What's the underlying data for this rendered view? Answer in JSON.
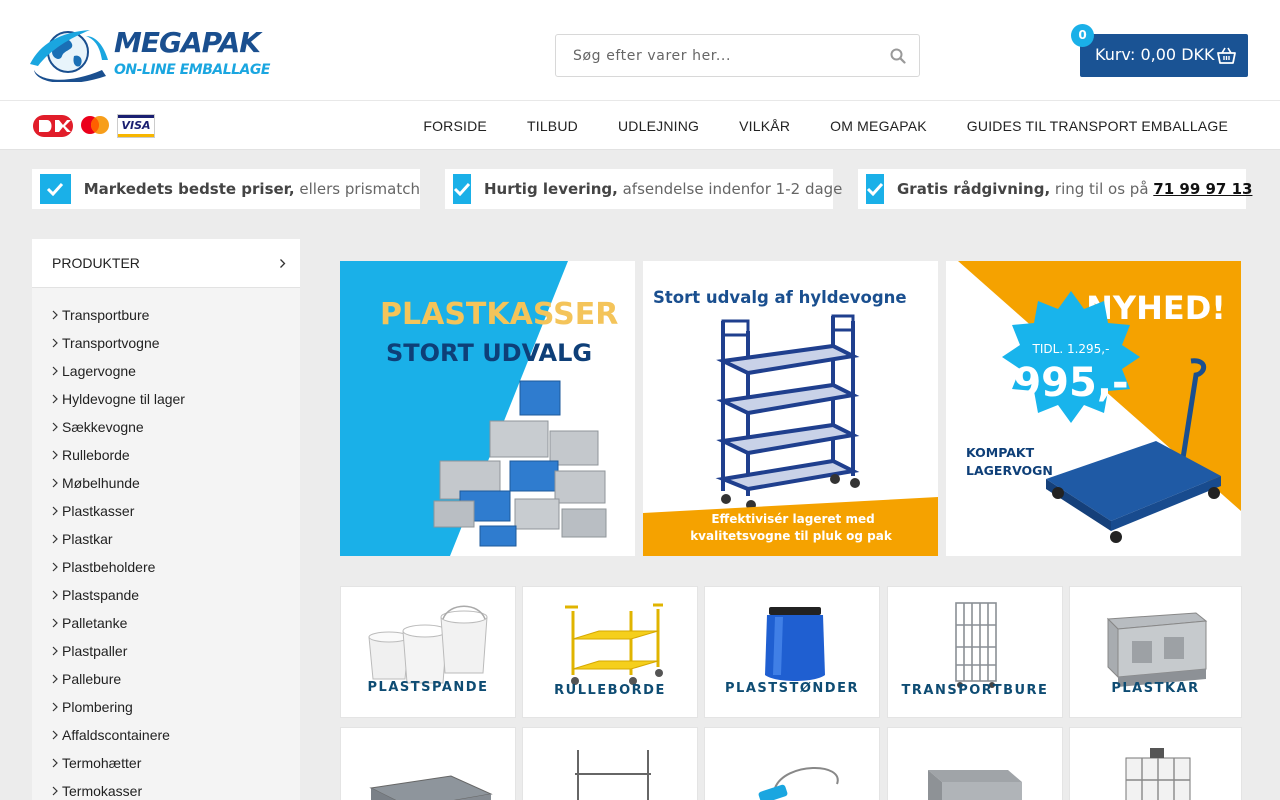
{
  "header": {
    "logo_title": "MEGAPAK",
    "logo_subtitle": "ON-LINE EMBALLAGE",
    "search_placeholder": "Søg efter varer her...",
    "cart_label": "Kurv: 0,00 DKK",
    "cart_count": "0"
  },
  "payments": {
    "visa": "VISA"
  },
  "nav": [
    "FORSIDE",
    "TILBUD",
    "UDLEJNING",
    "VILKÅR",
    "OM MEGAPAK",
    "GUIDES TIL TRANSPORT EMBALLAGE"
  ],
  "usps": [
    {
      "bold": "Markedets bedste priser,",
      "text": " ellers prismatch"
    },
    {
      "bold": "Hurtig levering,",
      "text": " afsendelse indenfor 1-2 dage"
    },
    {
      "bold": "Gratis rådgivning,",
      "text": " ring til os på ",
      "phone": "71 99 97 13"
    }
  ],
  "sidebar": {
    "heading": "PRODUKTER",
    "items": [
      "Transportbure",
      "Transportvogne",
      "Lagervogne",
      "Hyldevogne til lager",
      "Sækkevogne",
      "Rulleborde",
      "Møbelhunde",
      "Plastkasser",
      "Plastkar",
      "Plastbeholdere",
      "Plastspande",
      "Palletanke",
      "Plastpaller",
      "Pallebure",
      "Plombering",
      "Affaldscontainere",
      "Termohætter",
      "Termokasser"
    ]
  },
  "banners": {
    "plastkasser": {
      "title": "PLASTKASSER",
      "subtitle": "STORT UDVALG"
    },
    "hyldevogne": {
      "title": "Stort udvalg af hyldevogne",
      "footer_line1": "Effektivisér lageret med",
      "footer_line2": "kvalitetsvogne til pluk og pak"
    },
    "nyhed": {
      "title": "NYHED!",
      "old_price": "TIDL. 1.295,-",
      "price": "995,-",
      "label_line1": "KOMPAKT",
      "label_line2": "LAGERVOGN"
    }
  },
  "tiles": [
    "PLASTSPANDE",
    "RULLEBORDE",
    "PLASTSTØNDER",
    "TRANSPORTBURE",
    "PLASTKAR"
  ],
  "colors": {
    "brand_blue": "#1a5394",
    "accent_cyan": "#1ab0e8",
    "orange": "#f5a200"
  }
}
